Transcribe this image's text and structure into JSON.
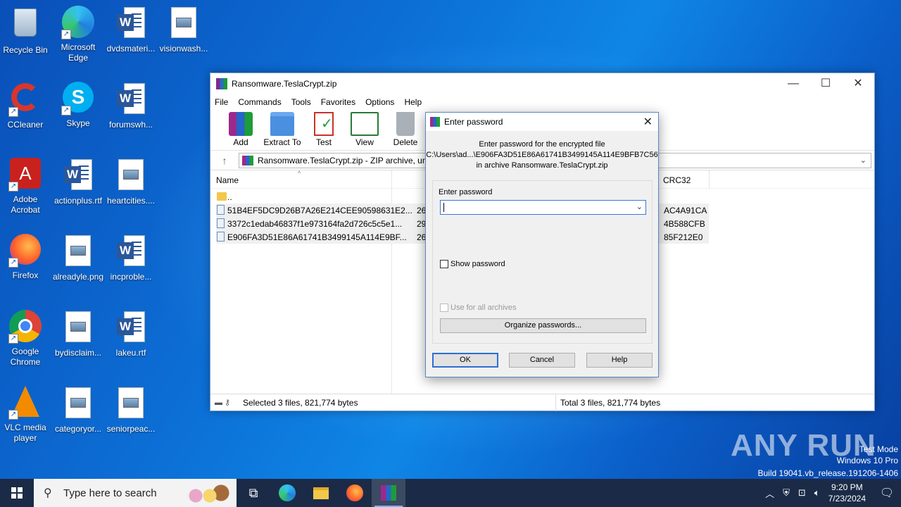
{
  "desktop": {
    "icons": [
      {
        "label": "Recycle Bin"
      },
      {
        "label": "Microsoft Edge"
      },
      {
        "label": "dvdsmateri..."
      },
      {
        "label": "visionwash..."
      },
      {
        "label": "CCleaner"
      },
      {
        "label": "Skype"
      },
      {
        "label": "forumswh..."
      },
      {
        "label": "Adobe Acrobat"
      },
      {
        "label": "actionplus.rtf"
      },
      {
        "label": "heartcities...."
      },
      {
        "label": "Firefox"
      },
      {
        "label": "alreadyle.png"
      },
      {
        "label": "incproble..."
      },
      {
        "label": "Google Chrome"
      },
      {
        "label": "bydisclaim..."
      },
      {
        "label": "lakeu.rtf"
      },
      {
        "label": "VLC media player"
      },
      {
        "label": "categoryor..."
      },
      {
        "label": "seniorpeac..."
      }
    ]
  },
  "winrar": {
    "title": "Ransomware.TeslaCrypt.zip",
    "menu": [
      "File",
      "Commands",
      "Tools",
      "Favorites",
      "Options",
      "Help"
    ],
    "toolbar": [
      "Add",
      "Extract To",
      "Test",
      "View",
      "Delete"
    ],
    "path": "Ransomware.TeslaCrypt.zip - ZIP archive, un",
    "columns": {
      "name": "Name",
      "crc": "CRC32"
    },
    "rows": [
      {
        "name": "..",
        "size": "",
        "crc": ""
      },
      {
        "name": "51B4EF5DC9D26B7A26E214CEE90598631E2...",
        "size": "26",
        "crc": "AC4A91CA"
      },
      {
        "name": "3372c1edab46837f1e973164fa2d726c5c5e1...",
        "size": "29",
        "crc": "4B588CFB"
      },
      {
        "name": "E906FA3D51E86A61741B3499145A114E9BF...",
        "size": "26",
        "crc": "85F212E0"
      }
    ],
    "status_left": "Selected 3 files, 821,774 bytes",
    "status_right": "Total 3 files, 821,774 bytes"
  },
  "dialog": {
    "title": "Enter password",
    "message_line1": "Enter password for the encrypted file",
    "message_line2": "C:\\Users\\ad...\\E906FA3D51E86A61741B3499145A114E9BFB7C56",
    "message_line3": "in archive Ransomware.TeslaCrypt.zip",
    "field_label": "Enter password",
    "password_value": "",
    "show_password": "Show password",
    "use_for_all": "Use for all archives",
    "organize": "Organize passwords...",
    "ok": "OK",
    "cancel": "Cancel",
    "help": "Help"
  },
  "taskbar": {
    "search_placeholder": "Type here to search",
    "time": "9:20 PM",
    "date": "7/23/2024"
  },
  "watermark": {
    "brand": "ANY RUN",
    "line1": "Test Mode",
    "line2": "Windows 10 Pro",
    "line3": "Build 19041.vb_release.191206-1406"
  }
}
